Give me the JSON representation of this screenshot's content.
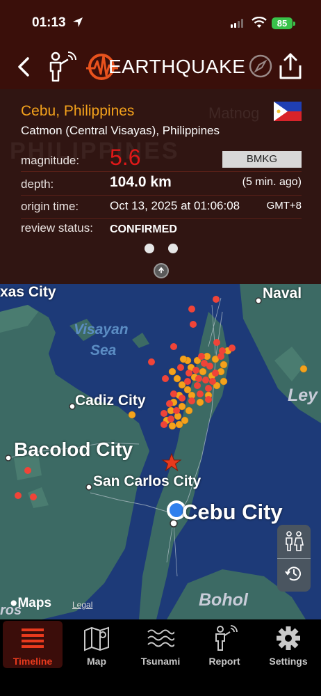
{
  "status_bar": {
    "time": "01:13",
    "battery": "85"
  },
  "header": {
    "title": "EARTHQUAKE"
  },
  "event": {
    "place": "Cebu, Philippines",
    "subregion": "Catmon (Central Visayas), Philippines",
    "magnitude_label": "magnitude:",
    "magnitude": "5.6",
    "source": "BMKG",
    "depth_label": "depth:",
    "depth": "104.0 km",
    "ago": "(5 min. ago)",
    "origin_label": "origin time:",
    "origin_time": "Oct 13, 2025 at 01:06:08",
    "timezone": "GMT+8",
    "review_label": "review status:",
    "review": "CONFIRMED"
  },
  "info_background": {
    "region": "PHILIPPINES",
    "town": "Matnog"
  },
  "map": {
    "labels": {
      "city1": "xas City",
      "city2": "Naval",
      "city3": "Cadiz City",
      "city4": "Bacolod City",
      "city5": "San Carlos City",
      "city6": "Cebu City",
      "city7": "Bohol",
      "city8": "Ley",
      "city9": "ros",
      "sea1": "Visayan",
      "sea2": "Sea"
    },
    "brand": "Maps",
    "legal": "Legal"
  },
  "tabs": [
    {
      "label": "Timeline",
      "icon": "timeline-list-icon",
      "active": true
    },
    {
      "label": "Map",
      "icon": "folded-map-icon"
    },
    {
      "label": "Tsunami",
      "icon": "waves-icon"
    },
    {
      "label": "Report",
      "icon": "person-reporting-icon"
    },
    {
      "label": "Settings",
      "icon": "gear-icon"
    }
  ],
  "colors": {
    "header_bg": "#3a0f0a",
    "panel_bg": "#301512",
    "accent": "#f4a21c",
    "magnitude": "#e01818",
    "active_tab": "#e83a1d",
    "recent_quake": "#f04438",
    "older_quake": "#f4a21c",
    "epicenter": "#e83a1d",
    "user_location": "#2f80ed"
  }
}
